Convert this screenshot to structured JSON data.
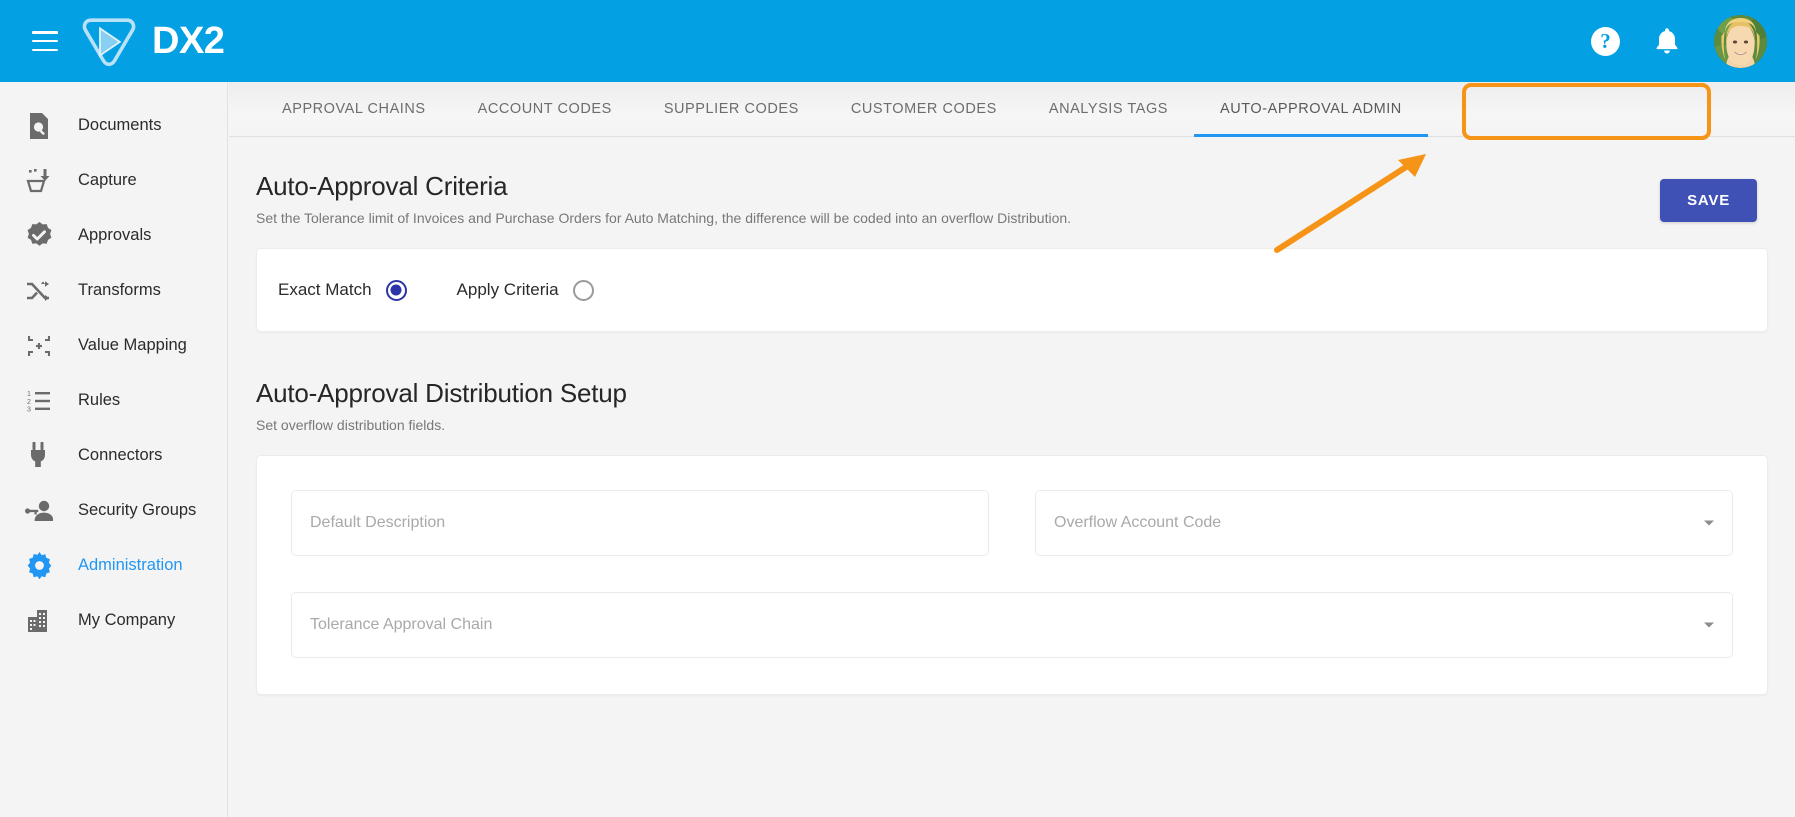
{
  "app": {
    "brand": "DX2",
    "menu_icon": "hamburger-icon",
    "help_icon": "?",
    "bell_icon": "bell-icon"
  },
  "sidebar": {
    "items": [
      {
        "label": "Documents",
        "icon": "document-search-icon",
        "active": false
      },
      {
        "label": "Capture",
        "icon": "capture-inbox-icon",
        "active": false
      },
      {
        "label": "Approvals",
        "icon": "verified-check-icon",
        "active": false
      },
      {
        "label": "Transforms",
        "icon": "shuffle-icon",
        "active": false
      },
      {
        "label": "Value Mapping",
        "icon": "collapse-arrows-icon",
        "active": false
      },
      {
        "label": "Rules",
        "icon": "numbered-list-icon",
        "active": false
      },
      {
        "label": "Connectors",
        "icon": "power-plug-icon",
        "active": false
      },
      {
        "label": "Security Groups",
        "icon": "key-user-icon",
        "active": false
      },
      {
        "label": "Administration",
        "icon": "gear-icon",
        "active": true
      },
      {
        "label": "My Company",
        "icon": "building-icon",
        "active": false
      }
    ]
  },
  "tabs": [
    {
      "label": "APPROVAL CHAINS",
      "active": false
    },
    {
      "label": "ACCOUNT CODES",
      "active": false
    },
    {
      "label": "SUPPLIER CODES",
      "active": false
    },
    {
      "label": "CUSTOMER CODES",
      "active": false
    },
    {
      "label": "ANALYSIS TAGS",
      "active": false
    },
    {
      "label": "AUTO-APPROVAL ADMIN",
      "active": true
    }
  ],
  "criteria": {
    "title": "Auto-Approval Criteria",
    "subtitle": "Set the Tolerance limit of Invoices and Purchase Orders for Auto Matching, the difference will be coded into an overflow Distribution.",
    "save_label": "SAVE",
    "options": [
      {
        "label": "Exact Match",
        "selected": true
      },
      {
        "label": "Apply Criteria",
        "selected": false
      }
    ]
  },
  "distribution": {
    "title": "Auto-Approval Distribution Setup",
    "subtitle": "Set overflow distribution fields.",
    "fields": [
      {
        "placeholder": "Default Description",
        "type": "text",
        "value": ""
      },
      {
        "placeholder": "Overflow Account Code",
        "type": "select",
        "value": ""
      },
      {
        "placeholder": "Tolerance Approval Chain",
        "type": "select",
        "value": ""
      }
    ]
  },
  "colors": {
    "brand_blue": "#03a0e4",
    "accent_blue": "#2196f3",
    "save_indigo": "#3f51b5",
    "radio_selected": "#2b35a8",
    "annotation_orange": "#f59416"
  }
}
